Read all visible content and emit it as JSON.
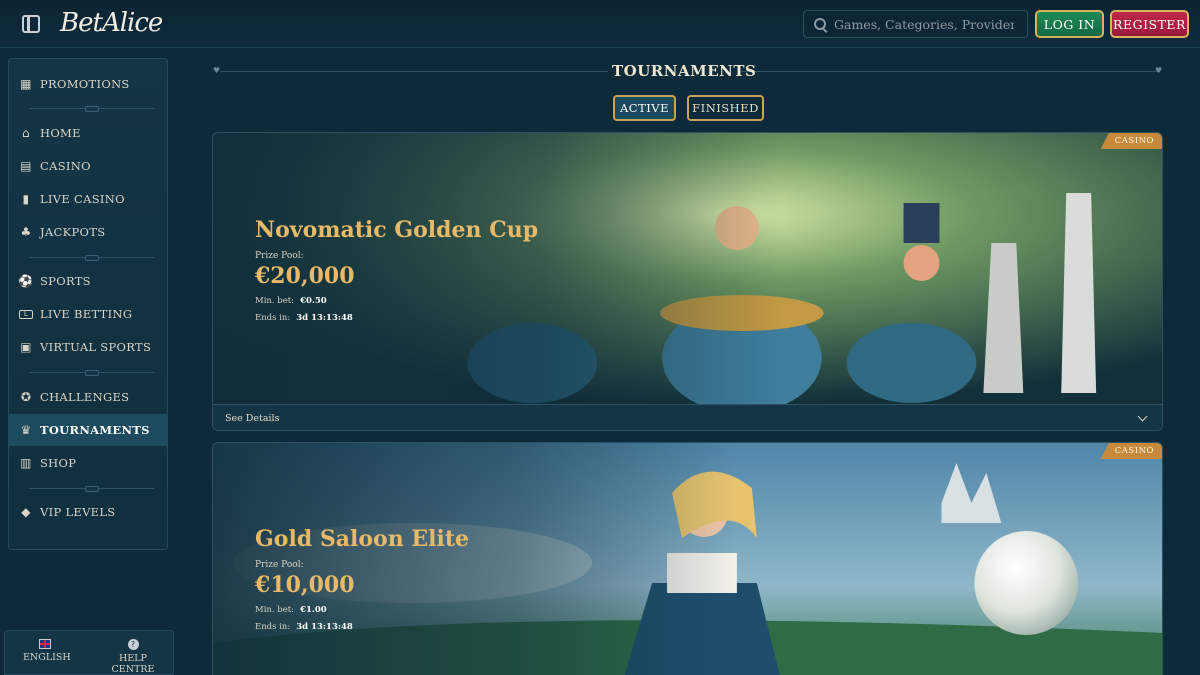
{
  "header": {
    "logo": "BetAlice",
    "search_placeholder": "Games, Categories, Providers",
    "login_label": "LOG IN",
    "register_label": "REGISTER"
  },
  "sidebar": {
    "items": [
      {
        "label": "PROMOTIONS",
        "icon": "gift-icon"
      },
      {
        "label": "HOME",
        "icon": "home-icon"
      },
      {
        "label": "CASINO",
        "icon": "slot-machine-icon"
      },
      {
        "label": "LIVE CASINO",
        "icon": "card-icon"
      },
      {
        "label": "JACKPOTS",
        "icon": "clover-icon"
      },
      {
        "label": "SPORTS",
        "icon": "ball-icon"
      },
      {
        "label": "LIVE BETTING",
        "icon": "live-icon"
      },
      {
        "label": "VIRTUAL SPORTS",
        "icon": "monitor-icon"
      },
      {
        "label": "CHALLENGES",
        "icon": "medal-icon"
      },
      {
        "label": "TOURNAMENTS",
        "icon": "trophy-icon",
        "active": true
      },
      {
        "label": "SHOP",
        "icon": "basket-icon"
      },
      {
        "label": "VIP LEVELS",
        "icon": "diamond-icon"
      }
    ]
  },
  "footer": {
    "language": "ENGLISH",
    "help": "HELP CENTRE"
  },
  "main": {
    "title": "TOURNAMENTS",
    "tabs": [
      "ACTIVE",
      "FINISHED"
    ],
    "tournaments": [
      {
        "badge": "CASINO",
        "name": "Novomatic Golden Cup",
        "prize_label": "Prize Pool:",
        "prize": "€20,000",
        "min_bet_label": "Min. bet:",
        "min_bet": "€0.50",
        "ends_label": "Ends in:",
        "ends": "3d 13:13:48",
        "details_label": "See Details"
      },
      {
        "badge": "CASINO",
        "name": "Gold Saloon Elite",
        "prize_label": "Prize Pool:",
        "prize": "€10,000",
        "min_bet_label": "Min. bet:",
        "min_bet": "€1.00",
        "ends_label": "Ends in:",
        "ends": "3d 13:13:48"
      }
    ]
  },
  "colors": {
    "background": "#0d2a3a",
    "accent_gold": "#e8b967",
    "login_green": "#1e8a58",
    "register_red": "#c0284c",
    "badge_orange": "#c68a3a"
  }
}
